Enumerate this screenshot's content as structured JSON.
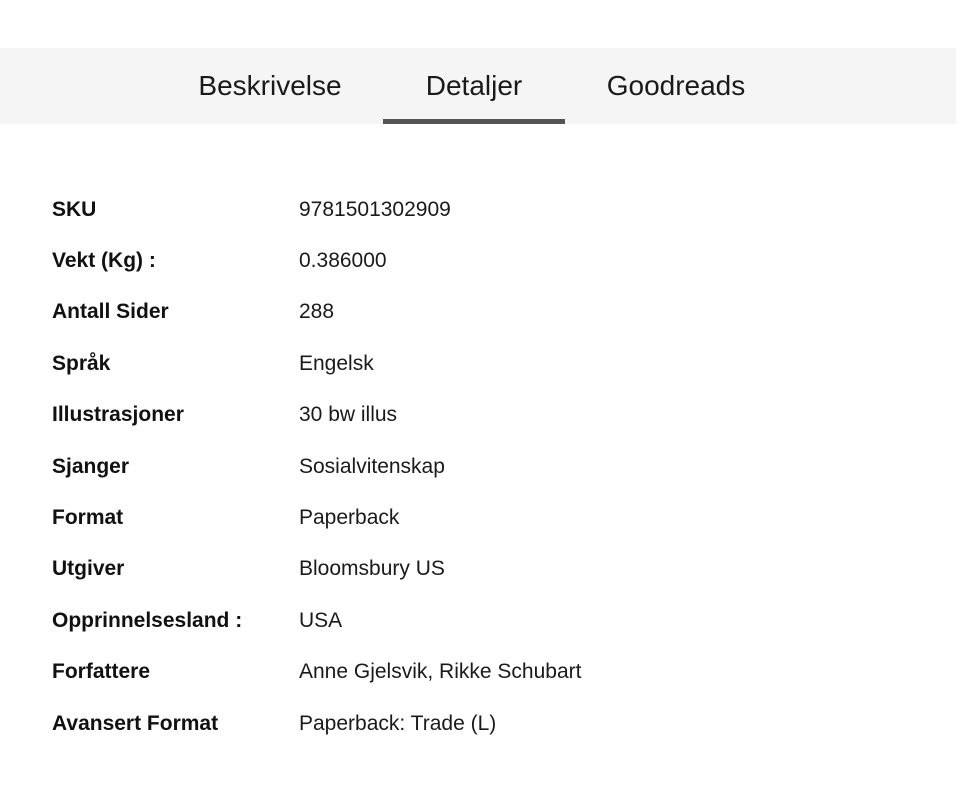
{
  "tabs": [
    {
      "label": "Beskrivelse",
      "active": false
    },
    {
      "label": "Detaljer",
      "active": true
    },
    {
      "label": "Goodreads",
      "active": false
    }
  ],
  "colors": {
    "tabbar_background": "#f5f5f5",
    "active_indicator": "#555555",
    "text": "#111111"
  },
  "details": [
    {
      "label": "SKU",
      "value": "9781501302909"
    },
    {
      "label": "Vekt (Kg) :",
      "value": "0.386000"
    },
    {
      "label": "Antall Sider",
      "value": "288"
    },
    {
      "label": "Språk",
      "value": "Engelsk"
    },
    {
      "label": "Illustrasjoner",
      "value": "30 bw illus"
    },
    {
      "label": "Sjanger",
      "value": "Sosialvitenskap"
    },
    {
      "label": "Format",
      "value": "Paperback"
    },
    {
      "label": "Utgiver",
      "value": "Bloomsbury US"
    },
    {
      "label": "Opprinnelsesland :",
      "value": "USA"
    },
    {
      "label": "Forfattere",
      "value": "Anne Gjelsvik, Rikke Schubart"
    },
    {
      "label": "Avansert Format",
      "value": "Paperback: Trade (L)"
    }
  ]
}
